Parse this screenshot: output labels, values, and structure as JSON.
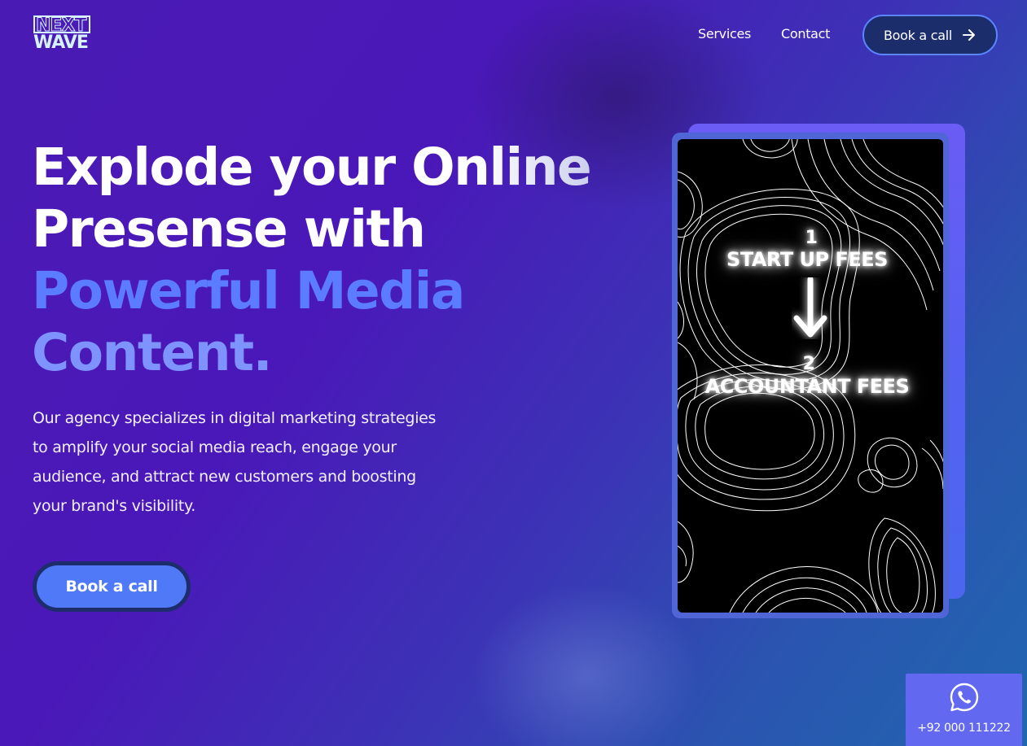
{
  "logo": {
    "line1": "NEXT",
    "line2": "WAVE"
  },
  "nav": {
    "items": [
      {
        "label": "Services"
      },
      {
        "label": "Contact"
      }
    ],
    "cta_label": "Book a call",
    "cta_icon": "arrow-right-icon"
  },
  "hero": {
    "title_line1": "Explode your Online",
    "title_line2": "Presense with",
    "title_line3": "Powerful Media",
    "title_line4": "Content.",
    "description": "Our agency specializes in digital marketing strategies to amplify your social media reach, engage your audience, and attract new customers and boosting your brand's visibility.",
    "cta_label": "Book a call"
  },
  "media_card": {
    "step1_number": "1",
    "step1_label": "START UP FEES",
    "step2_number": "2",
    "step2_label": "ACCOUNTANT FEES",
    "arrow_icon": "arrow-down-icon"
  },
  "whatsapp": {
    "icon": "whatsapp-icon",
    "phone": "+92 000 111222"
  },
  "colors": {
    "background_start": "#4a1ab4",
    "background_end": "#2166b0",
    "accent_blue": "#4f79f7",
    "title_accent": "#5b7cff",
    "button_border": "#1d2c6a",
    "whatsapp_bg": "#6269f0"
  }
}
